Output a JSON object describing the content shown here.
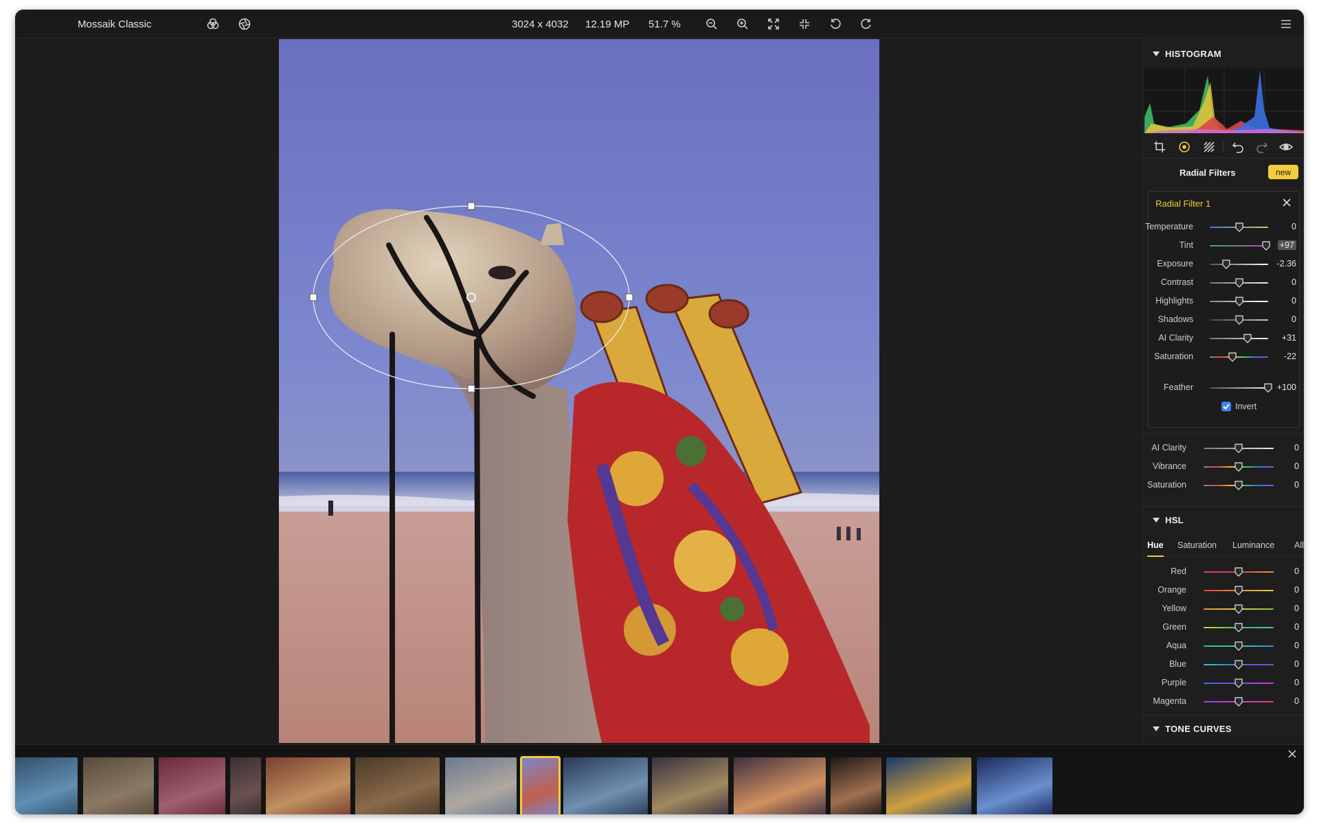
{
  "app": {
    "title": "Mossaik Classic"
  },
  "toolbar": {
    "dimensions": "3024 x 4032",
    "megapixels": "12.19 MP",
    "zoom": "51.7 %"
  },
  "panel": {
    "histogram_title": "HISTOGRAM",
    "radial_title": "Radial Filters",
    "new_label": "new",
    "filter_name": "Radial Filter 1",
    "filter_sliders": [
      {
        "label": "Temperature",
        "value": "0",
        "pos": 0.5
      },
      {
        "label": "Tint",
        "value": "+97",
        "pos": 0.97
      },
      {
        "label": "Exposure",
        "value": "-2.36",
        "pos": 0.28
      },
      {
        "label": "Contrast",
        "value": "0",
        "pos": 0.5
      },
      {
        "label": "Highlights",
        "value": "0",
        "pos": 0.5
      },
      {
        "label": "Shadows",
        "value": "0",
        "pos": 0.5
      },
      {
        "label": "AI Clarity",
        "value": "+31",
        "pos": 0.65
      },
      {
        "label": "Saturation",
        "value": "-22",
        "pos": 0.39
      }
    ],
    "feather": {
      "label": "Feather",
      "value": "+100",
      "pos": 1.0
    },
    "invert_label": "Invert",
    "invert_checked": true,
    "global_sliders": [
      {
        "label": "AI Clarity",
        "value": "0"
      },
      {
        "label": "Vibrance",
        "value": "0"
      },
      {
        "label": "Saturation",
        "value": "0"
      }
    ],
    "hsl_title": "HSL",
    "hsl_tabs": [
      "Hue",
      "Saturation",
      "Luminance",
      "All"
    ],
    "hsl_active_tab": "Hue",
    "hsl_sliders": [
      {
        "label": "Red",
        "value": "0"
      },
      {
        "label": "Orange",
        "value": "0"
      },
      {
        "label": "Yellow",
        "value": "0"
      },
      {
        "label": "Green",
        "value": "0"
      },
      {
        "label": "Aqua",
        "value": "0"
      },
      {
        "label": "Blue",
        "value": "0"
      },
      {
        "label": "Purple",
        "value": "0"
      },
      {
        "label": "Magenta",
        "value": "0"
      }
    ],
    "tone_curves_title": "TONE CURVES"
  },
  "colors": {
    "accent": "#f2cc3a",
    "checkbox": "#3b82f6",
    "window": "#1b1b1b"
  },
  "filmstrip": {
    "selected_index": 8,
    "thumbs": [
      "blue-wooden-house",
      "abandoned-room",
      "graffiti-wall",
      "arcade",
      "matryoshka-dolls",
      "market-stall",
      "bare-tree",
      "camel",
      "hot-air-balloon-lake",
      "cathedral-interior",
      "coastal-town-sunset",
      "tunnel-spiral",
      "person-silhouette",
      "jellyfish-blue"
    ]
  }
}
